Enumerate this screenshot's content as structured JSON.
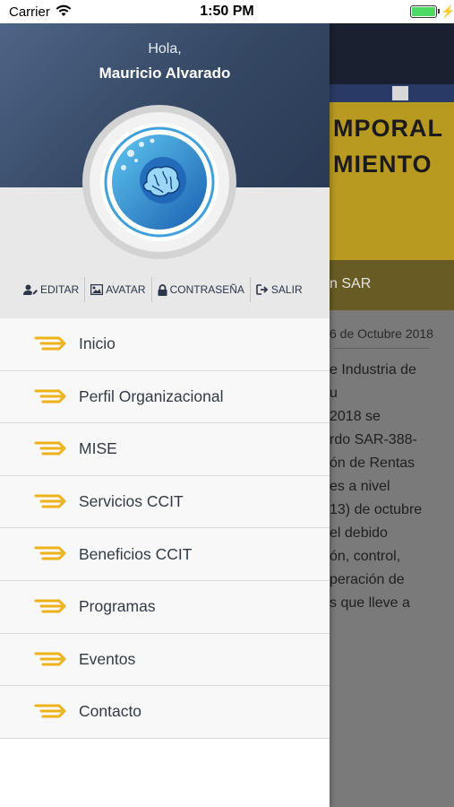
{
  "status_bar": {
    "carrier": "Carrier",
    "time": "1:50 PM",
    "battery_color": "#4cd964"
  },
  "drawer": {
    "greeting": "Hola,",
    "user_name": "Mauricio Alvarado",
    "avatar_icon": "brain-logo-icon",
    "actions": [
      {
        "label": "EDITAR",
        "icon": "user-edit-icon"
      },
      {
        "label": "AVATAR",
        "icon": "image-icon"
      },
      {
        "label": "CONTRASEÑA",
        "icon": "lock-icon"
      },
      {
        "label": "SALIR",
        "icon": "sign-out-icon"
      }
    ],
    "menu": [
      {
        "label": "Inicio",
        "icon": "speed-lines-icon"
      },
      {
        "label": "Perfil Organizacional",
        "icon": "speed-lines-icon"
      },
      {
        "label": "MISE",
        "icon": "speed-lines-icon"
      },
      {
        "label": "Servicios CCIT",
        "icon": "speed-lines-icon"
      },
      {
        "label": "Beneficios CCIT",
        "icon": "speed-lines-icon"
      },
      {
        "label": "Programas",
        "icon": "speed-lines-icon"
      },
      {
        "label": "Eventos",
        "icon": "speed-lines-icon"
      },
      {
        "label": "Contacto",
        "icon": "speed-lines-icon"
      }
    ],
    "header_color": "#344763",
    "icon_color": "#f0b21a"
  },
  "background": {
    "image_text_line1": "MPORAL",
    "image_text_line2": "MIENTO",
    "caption": "n SAR",
    "date": "6 de Octubre 2018",
    "article_lines": [
      "e Industria de",
      "u",
      "2018 se",
      "rdo SAR-388-",
      "ón de Rentas",
      "es a nivel",
      "13) de octubre",
      "el debido",
      "ón, control,",
      "peración de",
      "s que lleve a"
    ]
  }
}
